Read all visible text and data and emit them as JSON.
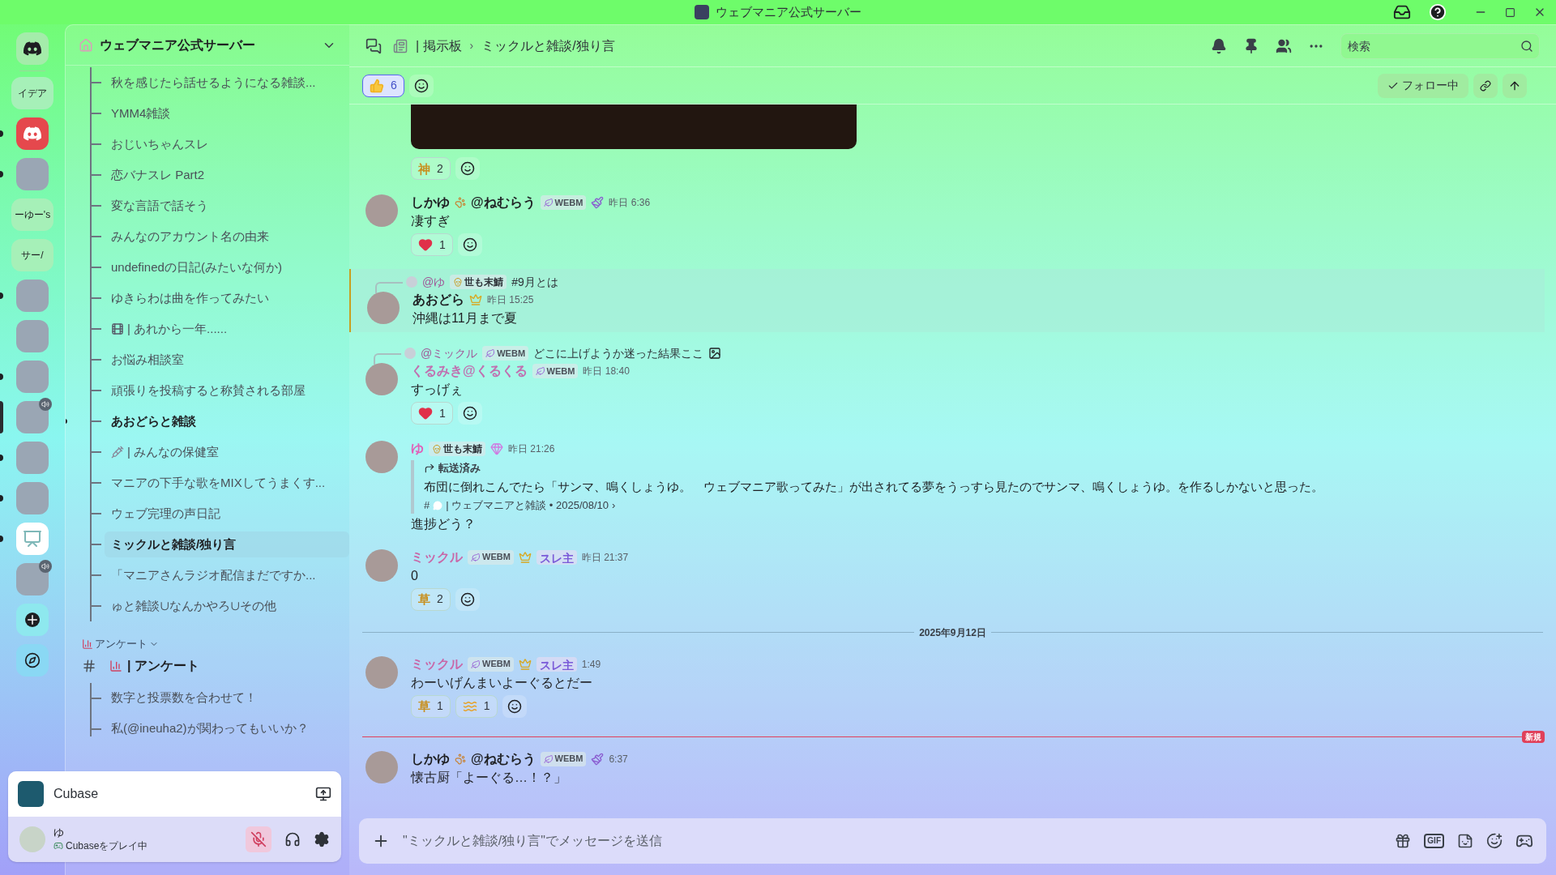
{
  "title_bar": {
    "title": "ウェブマニア公式サーバー"
  },
  "servers": [
    {
      "kind": "home",
      "unread": false,
      "selected": false
    },
    {
      "kind": "text",
      "label": "イデア",
      "unread": false,
      "selected": false
    },
    {
      "kind": "logo",
      "unread": true,
      "selected": false
    },
    {
      "kind": "avatar",
      "unread": true,
      "selected": false,
      "voice": false
    },
    {
      "kind": "text",
      "label": "ーゆー's",
      "unread": false,
      "selected": false
    },
    {
      "kind": "text",
      "label": "サー/",
      "unread": false,
      "selected": false
    },
    {
      "kind": "avatar",
      "unread": true,
      "selected": false,
      "voice": false
    },
    {
      "kind": "avatar",
      "unread": false,
      "selected": false,
      "voice": false
    },
    {
      "kind": "avatar",
      "unread": true,
      "selected": false,
      "voice": false
    },
    {
      "kind": "avatar",
      "unread": false,
      "selected": true,
      "voice": true
    },
    {
      "kind": "avatar",
      "unread": true,
      "selected": false,
      "voice": false
    },
    {
      "kind": "avatar",
      "unread": true,
      "selected": false,
      "voice": false
    },
    {
      "kind": "easel",
      "unread": true,
      "selected": false
    },
    {
      "kind": "avatar",
      "unread": false,
      "selected": false,
      "voice": true
    },
    {
      "kind": "add",
      "unread": false,
      "selected": false
    },
    {
      "kind": "explore",
      "unread": false,
      "selected": false
    }
  ],
  "sidebar": {
    "server_name": "ウェブマニア公式サーバー",
    "threads": [
      {
        "label": "秋を感じたら話せるようになる雑談...",
        "unread": false,
        "selected": false
      },
      {
        "label": "YMM4雑談",
        "unread": false,
        "selected": false
      },
      {
        "label": "おじいちゃんスレ",
        "unread": false,
        "selected": false
      },
      {
        "label": "恋バナスレ Part2",
        "unread": false,
        "selected": false
      },
      {
        "label": "変な言語で話そう",
        "unread": false,
        "selected": false
      },
      {
        "label": "みんなのアカウント名の由来",
        "unread": false,
        "selected": false
      },
      {
        "label": "undefinedの日記(みたいな何か)",
        "unread": false,
        "selected": false
      },
      {
        "label": "ゆきらわは曲を作ってみたい",
        "unread": false,
        "selected": false
      },
      {
        "label": "| あれから一年......",
        "unread": false,
        "selected": false,
        "kind": "film"
      },
      {
        "label": "お悩み相談室",
        "unread": false,
        "selected": false
      },
      {
        "label": "頑張りを投稿すると称賛される部屋",
        "unread": false,
        "selected": false
      },
      {
        "label": "あおどらと雑談",
        "unread": true,
        "selected": false
      },
      {
        "label": "| みんなの保健室",
        "unread": false,
        "selected": false,
        "kind": "syringe"
      },
      {
        "label": "マニアの下手な歌をMIXしてうまくす...",
        "unread": false,
        "selected": false
      },
      {
        "label": "ウェブ完理の声日記",
        "unread": false,
        "selected": false
      },
      {
        "label": "ミックルと雑談/独り言",
        "unread": false,
        "selected": true
      },
      {
        "label": "「マニアさんラジオ配信まだですか...",
        "unread": false,
        "selected": false
      },
      {
        "label": "ゅと雑談∪なんかやろ∪その他",
        "unread": false,
        "selected": false
      }
    ],
    "category": {
      "label": "アンケート",
      "expanded": true
    },
    "channel": {
      "label": "| アンケート",
      "unread": true
    },
    "channel_threads": [
      {
        "label": "数字と投票数を合わせて！",
        "unread": false,
        "selected": false
      },
      {
        "label": "私(@ineuha2)が関わってもいいか？",
        "unread": false,
        "selected": false
      }
    ]
  },
  "activity": {
    "app": "Cubase"
  },
  "user": {
    "name": "ゆ",
    "status": "Cubaseをプレイ中",
    "muted": true
  },
  "header": {
    "parent": "| 掲示板",
    "separator": "›",
    "thread": "ミックルと雑談/独り言",
    "search_placeholder": "検索"
  },
  "thread_bar": {
    "reactions": [
      {
        "kind": "thumbs",
        "count": "6",
        "selected": true
      }
    ],
    "follow": "フォロー中",
    "following": true
  },
  "messages": [
    {
      "kind": "image_tail",
      "reactions": [
        {
          "kind": "text",
          "emoji": "神",
          "count": "2",
          "selected": false
        }
      ]
    },
    {
      "kind": "message",
      "author": "しかゆ",
      "author_suffix": "@ねむらう",
      "color": "#1e1f22",
      "badges": [
        {
          "kind": "tag",
          "label": "WEBM"
        },
        {
          "kind": "brush"
        }
      ],
      "time": "昨日 6:36",
      "lines": [
        "凄すぎ"
      ],
      "highlighted": false,
      "reactions": [
        {
          "kind": "heart",
          "count": "1",
          "selected": false
        }
      ]
    },
    {
      "kind": "message",
      "reply": {
        "author": "@ゆ",
        "badges": [
          {
            "kind": "skull_tag",
            "label": "世も末鯖"
          }
        ],
        "text": "#9月とは",
        "attachment": false
      },
      "author": "あおどら",
      "color": "#1e1f22",
      "badges": [
        {
          "kind": "crown"
        }
      ],
      "time": "昨日 15:25",
      "lines": [
        "沖縄は11月まで夏"
      ],
      "highlighted": true
    },
    {
      "kind": "message",
      "reply": {
        "author": "@ミックル",
        "badges": [
          {
            "kind": "tag",
            "label": "WEBM"
          }
        ],
        "text": "どこに上げようか迷った結果ここ",
        "attachment": true
      },
      "author": "くるみき@くるくる",
      "color": "#c070b0",
      "badges": [
        {
          "kind": "tag",
          "label": "WEBM"
        }
      ],
      "time": "昨日 18:40",
      "lines": [
        "すっげぇ"
      ],
      "highlighted": false,
      "reactions": [
        {
          "kind": "heart",
          "count": "1",
          "selected": false
        }
      ]
    },
    {
      "kind": "message",
      "author": "ゆ",
      "color": "#e060b8",
      "badges": [
        {
          "kind": "skull_tag",
          "label": "世も末鯖"
        },
        {
          "kind": "gem"
        }
      ],
      "time": "昨日 21:26",
      "forward": {
        "label": "転送済み",
        "text": "布団に倒れこんでたら「サンマ、鳴くしょうゆ。　ウェブマニア歌ってみた」が出されてる夢をうっすら見たのでサンマ、鳴くしょうゆ。を作るしかないと思った。",
        "source_hash": "#",
        "source": "| ウェブマニアと雑談 • 2025/08/10",
        "source_arrow": "›"
      },
      "lines": [
        "進捗どう？"
      ],
      "highlighted": false
    },
    {
      "kind": "message",
      "author": "ミックル",
      "color": "#c868a8",
      "badges": [
        {
          "kind": "tag",
          "label": "WEBM"
        },
        {
          "kind": "crown"
        },
        {
          "kind": "role",
          "label": "スレ主"
        }
      ],
      "time": "昨日 21:37",
      "lines": [
        "0"
      ],
      "highlighted": false,
      "reactions": [
        {
          "kind": "text",
          "emoji": "草",
          "count": "2",
          "selected": false
        }
      ]
    },
    {
      "kind": "date_divider",
      "label": "2025年9月12日"
    },
    {
      "kind": "message",
      "author": "ミックル",
      "color": "#c868a8",
      "badges": [
        {
          "kind": "tag",
          "label": "WEBM"
        },
        {
          "kind": "crown"
        },
        {
          "kind": "role",
          "label": "スレ主"
        }
      ],
      "time": "1:49",
      "lines": [
        "わーいげんまいよーぐるとだー"
      ],
      "highlighted": false,
      "reactions": [
        {
          "kind": "text",
          "emoji": "草",
          "count": "1",
          "selected": false
        },
        {
          "kind": "swimmer",
          "count": "1",
          "selected": false
        }
      ]
    },
    {
      "kind": "new_divider",
      "label": "新規"
    },
    {
      "kind": "message",
      "author": "しかゆ",
      "author_suffix": "@ねむらう",
      "color": "#1e1f22",
      "badges": [
        {
          "kind": "tag",
          "label": "WEBM"
        },
        {
          "kind": "brush"
        }
      ],
      "time": "6:37",
      "lines": [
        "懐古厨「よーぐる…！？」"
      ],
      "highlighted": false
    }
  ],
  "composer": {
    "placeholder": "\"ミックルと雑談/独り言\"でメッセージを送信",
    "gif_label": "GIF"
  }
}
